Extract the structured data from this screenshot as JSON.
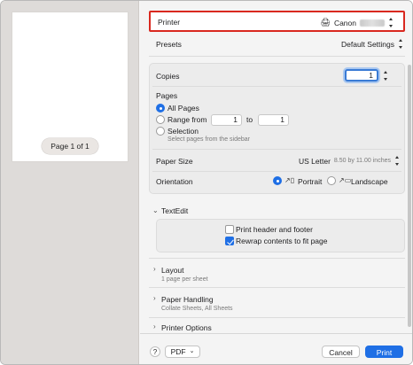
{
  "preview": {
    "page_indicator": "Page 1 of 1"
  },
  "printer": {
    "label": "Printer",
    "value": "Canon",
    "icon": "printer-icon"
  },
  "presets": {
    "label": "Presets",
    "value": "Default Settings"
  },
  "copies": {
    "label": "Copies",
    "value": "1"
  },
  "pages": {
    "label": "Pages",
    "all_pages": "All Pages",
    "range_from": "Range from",
    "range_start": "1",
    "range_to": "to",
    "range_end": "1",
    "selection": "Selection",
    "selection_hint": "Select pages from the sidebar"
  },
  "paper_size": {
    "label": "Paper Size",
    "value": "US Letter",
    "detail": "8.50 by 11.00 inches"
  },
  "orientation": {
    "label": "Orientation",
    "portrait": "Portrait",
    "landscape": "Landscape"
  },
  "textedit": {
    "label": "TextEdit",
    "print_header_footer": "Print header and footer",
    "rewrap": "Rewrap contents to fit page"
  },
  "layout": {
    "label": "Layout",
    "summary": "1 page per sheet"
  },
  "paper_handling": {
    "label": "Paper Handling",
    "summary": "Collate Sheets, All Sheets"
  },
  "printer_options": {
    "label": "Printer Options"
  },
  "footer": {
    "help": "?",
    "pdf": "PDF",
    "cancel": "Cancel",
    "print": "Print"
  },
  "colors": {
    "accent": "#1f6fe5",
    "highlight": "#d9281f"
  }
}
